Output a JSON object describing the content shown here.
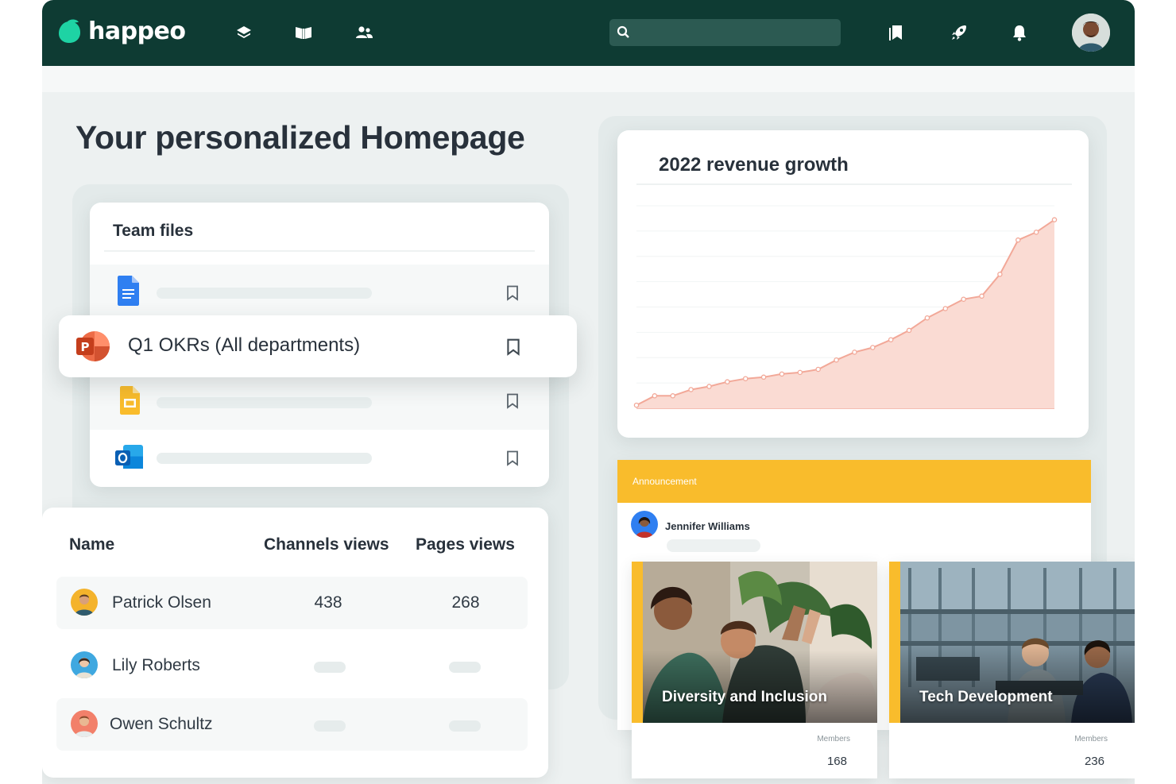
{
  "brand": {
    "name": "happeo",
    "accent": "#1ed3a4",
    "topbar_color": "#0e3b33"
  },
  "topbar": {
    "nav_icons": [
      "layers-icon",
      "book-open-icon",
      "people-icon"
    ],
    "search": {
      "placeholder": "",
      "value": ""
    },
    "right_icons": [
      "bookmarks-icon",
      "rocket-icon",
      "bell-icon"
    ]
  },
  "page": {
    "title": "Your personalized Homepage"
  },
  "team_files": {
    "title": "Team files",
    "featured": {
      "label": "Q1 OKRs (All departments)",
      "icon": "powerpoint-icon"
    },
    "placeholder_icons": [
      "google-docs-icon",
      "google-slides-icon",
      "outlook-icon"
    ]
  },
  "analytics_table": {
    "columns": [
      "Name",
      "Channels views",
      "Pages views"
    ],
    "rows": [
      {
        "name": "Patrick Olsen",
        "channels_views": "438",
        "pages_views": "268"
      },
      {
        "name": "Lily Roberts",
        "channels_views": "",
        "pages_views": ""
      },
      {
        "name": "Owen Schultz",
        "channels_views": "",
        "pages_views": ""
      }
    ]
  },
  "chart": {
    "title": "2022 revenue growth",
    "fill_color": "#fadbd3",
    "line_color": "#f2a898"
  },
  "chart_data": {
    "type": "area",
    "title": "2022 revenue growth",
    "xlabel": "",
    "ylabel": "",
    "x": [
      1,
      2,
      3,
      4,
      5,
      6,
      7,
      8,
      9,
      10,
      11,
      12,
      13,
      14,
      15,
      16,
      17,
      18,
      19,
      20,
      21,
      22,
      23,
      24
    ],
    "values": [
      2,
      8,
      8,
      12,
      14,
      17,
      19,
      20,
      22,
      23,
      25,
      31,
      36,
      39,
      44,
      50,
      58,
      64,
      70,
      72,
      86,
      108,
      113,
      121
    ],
    "ylim": [
      0,
      130
    ],
    "grid": true
  },
  "announcement": {
    "label": "Announcement",
    "author": "Jennifer Williams",
    "color": "#f9bc2c"
  },
  "groups": [
    {
      "name": "Diversity and Inclusion",
      "members_label": "Members",
      "members": "168"
    },
    {
      "name": "Tech Development",
      "members_label": "Members",
      "members": "236"
    }
  ]
}
